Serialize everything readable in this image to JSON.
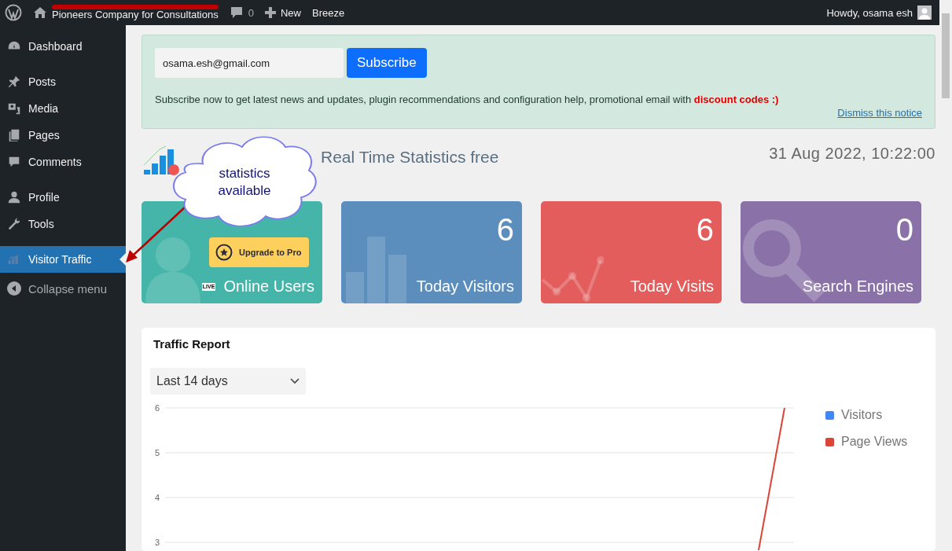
{
  "admin_bar": {
    "site_name": "Pioneers Company for Consultations",
    "comments_count": "0",
    "new_label": "New",
    "plugin_link": "Breeze",
    "greeting": "Howdy, osama esh"
  },
  "sidebar": {
    "items": [
      {
        "label": "Dashboard",
        "selected": false
      },
      {
        "label": "Posts",
        "selected": false
      },
      {
        "label": "Media",
        "selected": false
      },
      {
        "label": "Pages",
        "selected": false
      },
      {
        "label": "Comments",
        "selected": false
      },
      {
        "label": "Profile",
        "selected": false
      },
      {
        "label": "Tools",
        "selected": false
      },
      {
        "label": "Visitor Traffic",
        "selected": true
      }
    ],
    "collapse": "Collapse menu"
  },
  "notice": {
    "email_value": "osama.esh@gmail.com",
    "button": "Subscribe",
    "message": "Subscribe now to get latest news and updates, plugin recommendations and configuration help, promotional email with **discount codes :)**",
    "dismiss": "Dismiss this notice"
  },
  "plugin": {
    "title": "Real Time Statistics free",
    "datetime": "31 Aug 2022, 10:22:00"
  },
  "callout": {
    "text": "statistics available"
  },
  "stats": [
    {
      "kind": "online",
      "label": "Online Users",
      "upgrade": "Upgrade to Pro",
      "live": "LIVE"
    },
    {
      "kind": "visitors",
      "value": "6",
      "label": "Today Visitors"
    },
    {
      "kind": "visits",
      "value": "6",
      "label": "Today Visits"
    },
    {
      "kind": "search",
      "value": "0",
      "label": "Search Engines"
    }
  ],
  "traffic": {
    "title": "Traffic Report",
    "range": "Last 14 days",
    "y_labels": [
      "6",
      "5",
      "4",
      "3"
    ],
    "legend": [
      {
        "label": "Visitors",
        "color": "#4285f4"
      },
      {
        "label": "Page Views",
        "color": "#db4437"
      }
    ]
  }
}
